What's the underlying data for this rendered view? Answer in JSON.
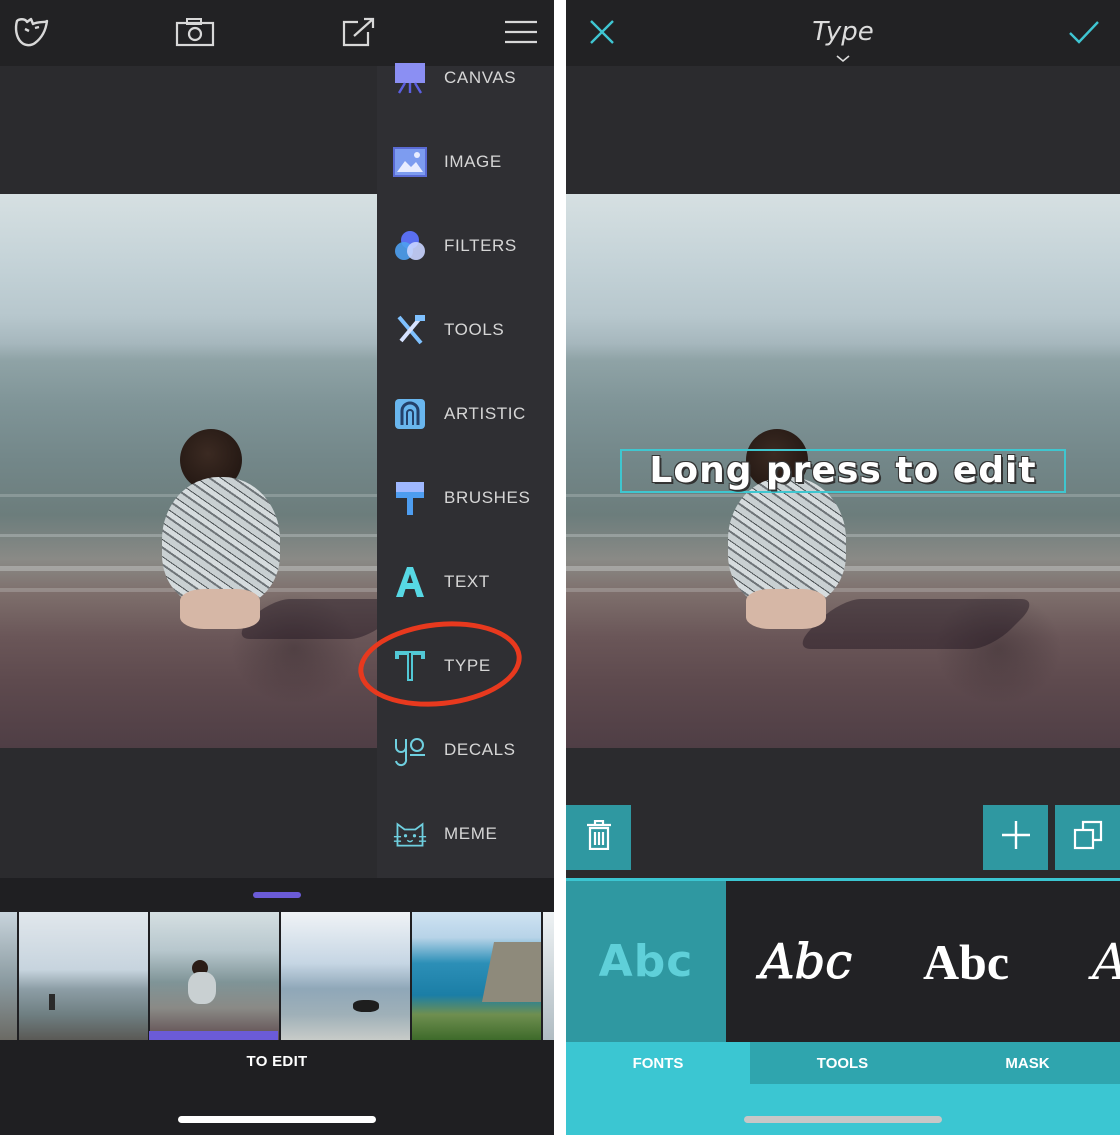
{
  "left": {
    "menu": {
      "items": [
        {
          "label": "CANVAS",
          "icon": "canvas-icon"
        },
        {
          "label": "IMAGE",
          "icon": "image-icon"
        },
        {
          "label": "FILTERS",
          "icon": "filters-icon"
        },
        {
          "label": "TOOLS",
          "icon": "tools-icon"
        },
        {
          "label": "ARTISTIC",
          "icon": "artistic-icon"
        },
        {
          "label": "BRUSHES",
          "icon": "brushes-icon"
        },
        {
          "label": "TEXT",
          "icon": "text-icon"
        },
        {
          "label": "TYPE",
          "icon": "type-icon"
        },
        {
          "label": "DECALS",
          "icon": "decals-icon"
        },
        {
          "label": "MEME",
          "icon": "meme-icon"
        }
      ]
    },
    "to_edit": "TO EDIT"
  },
  "right": {
    "title": "Type",
    "overlay_text": "Long press to edit",
    "fonts": [
      "Abc",
      "Abc",
      "Abc",
      "A"
    ],
    "tabs": [
      "FONTS",
      "TOOLS",
      "MASK"
    ],
    "accent_color": "#3bc6d2"
  }
}
